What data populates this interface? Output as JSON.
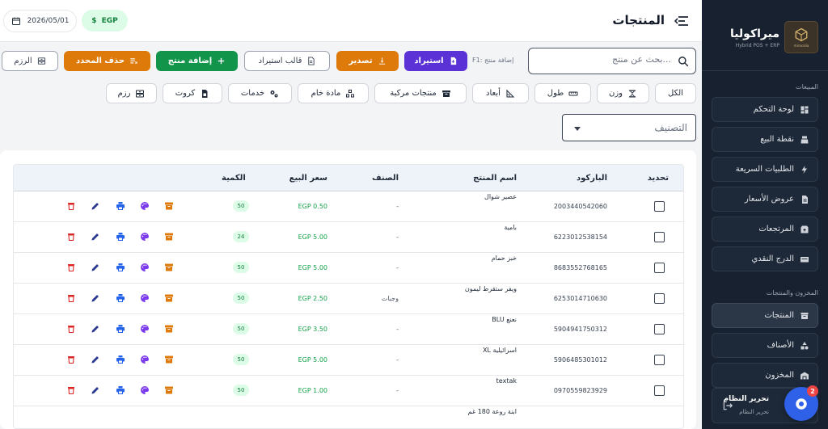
{
  "colors": {
    "sidebar_bg": "#17212f",
    "purple": "#5b32d6",
    "orange": "#dd7a0a",
    "green": "#12954b",
    "delete": "#dc2626",
    "edit": "#2b3a8f",
    "print": "#2563eb",
    "palette": "#7c3aed",
    "archive": "#dd7a0a",
    "help": "#2f61e8"
  },
  "brand": {
    "name": "ميراكوليا",
    "subtitle": "Hybrid POS + ERP",
    "logo_caption": "miracolia"
  },
  "header": {
    "title": "المنتجات",
    "date": "2026/05/01",
    "currency": "EGP"
  },
  "sidebar": {
    "section1": "المبيعات",
    "items1": [
      {
        "label": "لوحة التحكم",
        "icon": "dashboard-icon"
      },
      {
        "label": "نقطة البيع",
        "icon": "cash-register-icon"
      },
      {
        "label": "الطلبيات السريعة",
        "icon": "bolt-icon"
      },
      {
        "label": "عروض الأسعار",
        "icon": "document-icon"
      },
      {
        "label": "المرتجعات",
        "icon": "return-box-icon"
      },
      {
        "label": "الدرج النقدي",
        "icon": "cash-drawer-icon"
      }
    ],
    "section2": "المخزون والمنتجات",
    "items2": [
      {
        "label": "المنتجات",
        "icon": "box-icon",
        "active": true
      },
      {
        "label": "الأصناف",
        "icon": "shapes-icon"
      },
      {
        "label": "المخزون",
        "icon": "warehouse-icon"
      }
    ],
    "footer": {
      "title": "تحرير النظام",
      "subtitle": "تحرير النظام"
    },
    "help_badge": "2"
  },
  "toolbar": {
    "search_placeholder": "بحث عن منتج...",
    "hint": "F1: إضافة منتج",
    "import": "استيراد",
    "export": "تصدير",
    "template": "قالب استيراد",
    "add": "إضافة منتج",
    "delete_selected": "حذف المحدد",
    "bundles": "الرزم"
  },
  "filters": {
    "chips": [
      {
        "label": "الكل"
      },
      {
        "label": "وزن",
        "icon": "scale-icon"
      },
      {
        "label": "طول",
        "icon": "ruler-icon"
      },
      {
        "label": "أبعاد",
        "icon": "dimensions-icon"
      },
      {
        "label": "منتجات مركبة",
        "icon": "archive-icon"
      },
      {
        "label": "مادة خام",
        "icon": "cubes-icon"
      },
      {
        "label": "خدمات",
        "icon": "gears-icon"
      },
      {
        "label": "كروت",
        "icon": "sim-card-icon"
      },
      {
        "label": "رزم",
        "icon": "bundle-icon"
      }
    ],
    "category_placeholder": "التصنيف"
  },
  "table": {
    "columns": {
      "select": "تحديد",
      "barcode": "الباركود",
      "name": "اسم المنتج",
      "category": "الصنف",
      "price": "سعر البيع",
      "qty": "الكمية"
    },
    "rows": [
      {
        "barcode": "2003440542060",
        "name": "عصير شوال",
        "category": "-",
        "price": "EGP 0.50",
        "qty": "50"
      },
      {
        "barcode": "6223012538154",
        "name": "بامية",
        "category": "-",
        "price": "EGP 5.00",
        "qty": "24"
      },
      {
        "barcode": "8683552768165",
        "name": "خبز حمام",
        "category": "-",
        "price": "EGP 5.00",
        "qty": "50"
      },
      {
        "barcode": "6253014710630",
        "name": "ويفر ستقرط ليمون",
        "category": "وجبات",
        "price": "EGP 2.50",
        "qty": "50"
      },
      {
        "barcode": "5904941750312",
        "name": "BLU نعنع",
        "category": "-",
        "price": "EGP 3.50",
        "qty": "50"
      },
      {
        "barcode": "5906485301012",
        "name": "XL اسرائيلية",
        "category": "-",
        "price": "EGP 5.00",
        "qty": "50"
      },
      {
        "barcode": "0970559823929",
        "name": "textak",
        "category": "-",
        "price": "EGP 1.00",
        "qty": "50"
      },
      {
        "barcode": "",
        "name": "ابنة روعة 180 غم",
        "category": "",
        "price": "",
        "qty": ""
      }
    ]
  }
}
